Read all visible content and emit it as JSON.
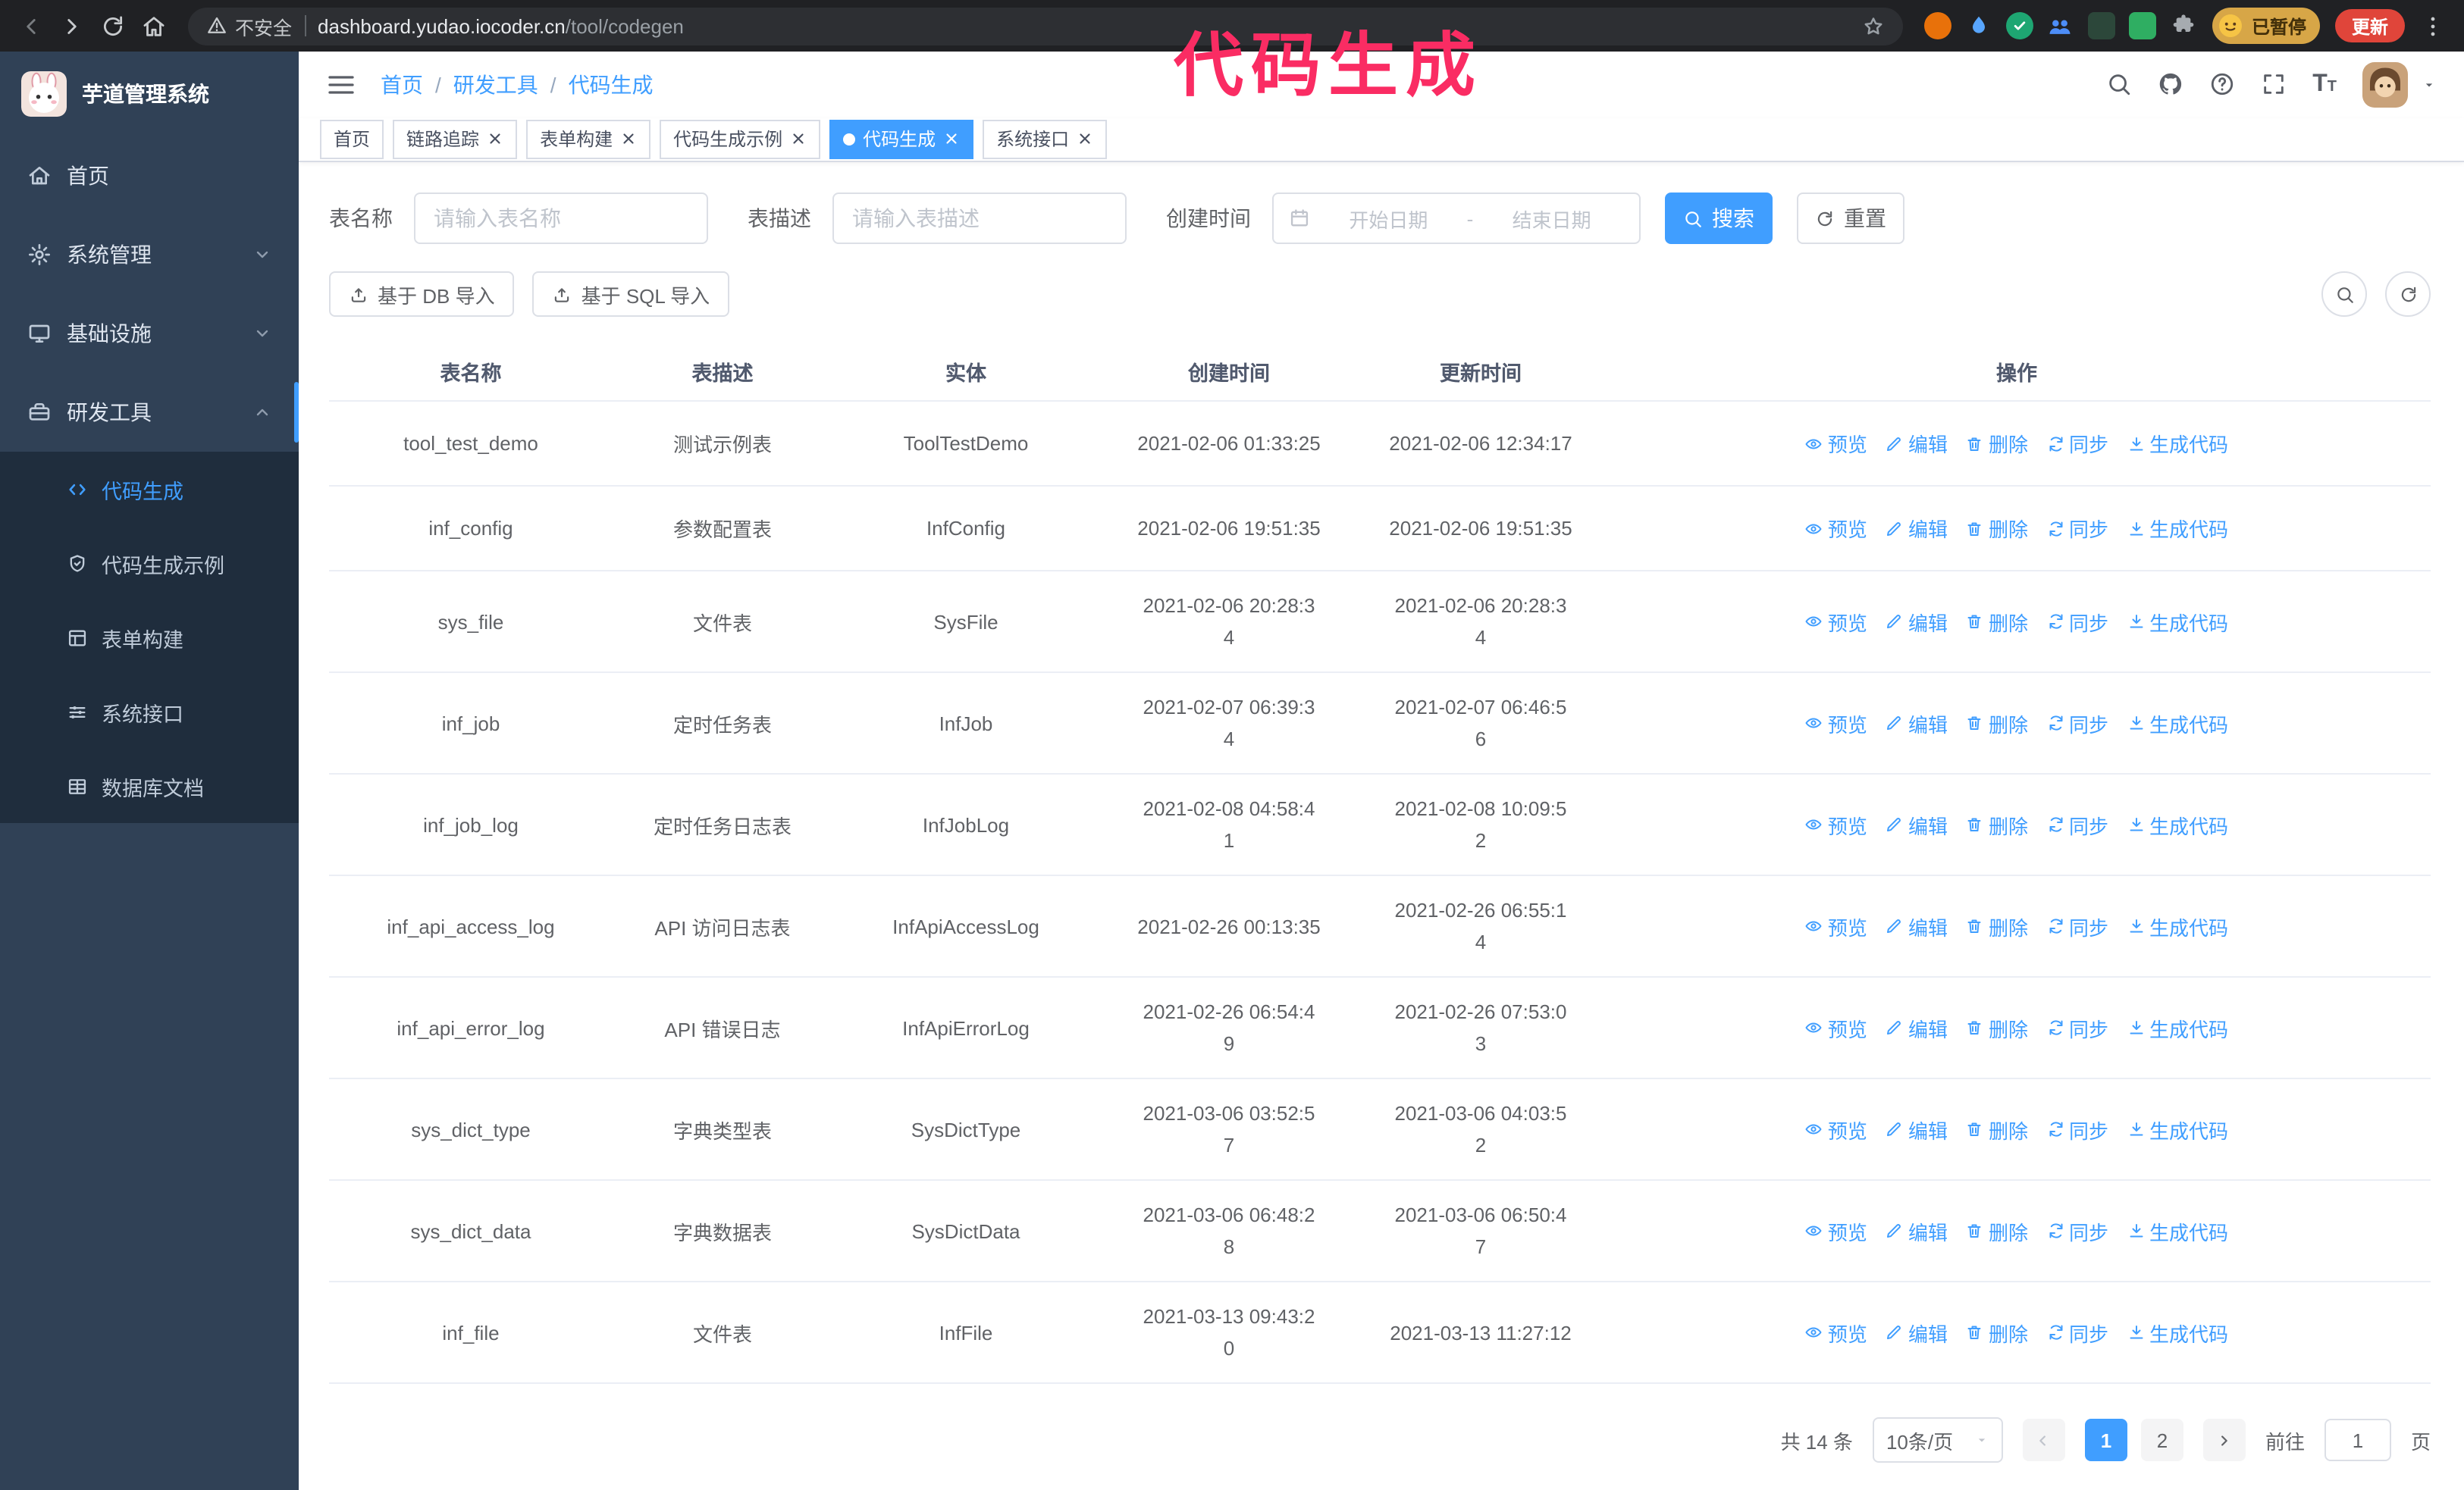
{
  "annotation": {
    "text": "代码生成",
    "color": "#fa2c63"
  },
  "browser": {
    "security_warning": "不安全",
    "url_domain": "dashboard.yudao.iocoder.cn",
    "url_path": "/tool/codegen",
    "sync_badge": "已暂停",
    "update_button": "更新",
    "extensions": [
      {
        "name": "orange-extension-icon",
        "kind": "circle",
        "color": "#e8710a"
      },
      {
        "name": "blue-drop-extension-icon",
        "kind": "drop",
        "color": "#58a6ff"
      },
      {
        "name": "green-check-extension-icon",
        "kind": "check",
        "color": "#1ea672"
      },
      {
        "name": "people-extension-icon",
        "kind": "people",
        "color": "#4d8df7"
      },
      {
        "name": "dark-green-extension-icon",
        "kind": "square",
        "color": "#2c473a"
      },
      {
        "name": "green-extension-icon",
        "kind": "square",
        "color": "#2fae62"
      },
      {
        "name": "puzzle-icon",
        "kind": "puzzle",
        "color": "#a6abb0"
      }
    ]
  },
  "sidebar": {
    "logo_title": "芋道管理系统",
    "items": [
      {
        "id": "home",
        "label": "首页",
        "icon": "home-icon"
      },
      {
        "id": "system",
        "label": "系统管理",
        "icon": "gear-icon",
        "expandable": true
      },
      {
        "id": "infra",
        "label": "基础设施",
        "icon": "infra-icon",
        "expandable": true
      },
      {
        "id": "devtools",
        "label": "研发工具",
        "icon": "tools-icon",
        "expanded": true
      }
    ],
    "submenu": [
      {
        "id": "codegen",
        "label": "代码生成",
        "icon": "code-icon",
        "active": true
      },
      {
        "id": "codegen-demo",
        "label": "代码生成示例",
        "icon": "example-icon"
      },
      {
        "id": "form-build",
        "label": "表单构建",
        "icon": "form-icon"
      },
      {
        "id": "api",
        "label": "系统接口",
        "icon": "api-icon"
      },
      {
        "id": "db-doc",
        "label": "数据库文档",
        "icon": "db-doc-icon"
      }
    ]
  },
  "navbar": {
    "breadcrumb": [
      "首页",
      "研发工具",
      "代码生成"
    ],
    "breadcrumb_separator": "/",
    "right_icons": [
      "search-icon",
      "github-icon",
      "help-icon",
      "fullscreen-icon",
      "font-size-icon",
      "avatar",
      "caret-down-icon"
    ]
  },
  "tabs": [
    {
      "label": "首页",
      "closable": false,
      "active": false
    },
    {
      "label": "链路追踪",
      "closable": true,
      "active": false
    },
    {
      "label": "表单构建",
      "closable": true,
      "active": false
    },
    {
      "label": "代码生成示例",
      "closable": true,
      "active": false
    },
    {
      "label": "代码生成",
      "closable": true,
      "active": true
    },
    {
      "label": "系统接口",
      "closable": true,
      "active": false
    }
  ],
  "filters": {
    "table_name_label": "表名称",
    "table_name_placeholder": "请输入表名称",
    "table_desc_label": "表描述",
    "table_desc_placeholder": "请输入表描述",
    "create_time_label": "创建时间",
    "date_start_placeholder": "开始日期",
    "date_separator": "-",
    "date_end_placeholder": "结束日期",
    "search_button": "搜索",
    "reset_button": "重置"
  },
  "toolbar": {
    "import_db": "基于 DB 导入",
    "import_sql": "基于 SQL 导入"
  },
  "table": {
    "columns": [
      "表名称",
      "表描述",
      "实体",
      "创建时间",
      "更新时间",
      "操作"
    ],
    "actions": [
      {
        "name": "preview-link",
        "label": "预览",
        "icon": "eye-icon"
      },
      {
        "name": "edit-link",
        "label": "编辑",
        "icon": "edit-icon"
      },
      {
        "name": "delete-link",
        "label": "删除",
        "icon": "delete-icon"
      },
      {
        "name": "sync-link",
        "label": "同步",
        "icon": "sync-icon"
      },
      {
        "name": "generate-code-link",
        "label": "生成代码",
        "icon": "download-icon"
      }
    ],
    "rows": [
      {
        "name": "tool_test_demo",
        "desc": "测试示例表",
        "entity": "ToolTestDemo",
        "created": "2021-02-06 01:33:25",
        "updated": "2021-02-06 12:34:17"
      },
      {
        "name": "inf_config",
        "desc": "参数配置表",
        "entity": "InfConfig",
        "created": "2021-02-06 19:51:35",
        "updated": "2021-02-06 19:51:35"
      },
      {
        "name": "sys_file",
        "desc": "文件表",
        "entity": "SysFile",
        "created": "2021-02-06 20:28:3\n4",
        "updated": "2021-02-06 20:28:3\n4"
      },
      {
        "name": "inf_job",
        "desc": "定时任务表",
        "entity": "InfJob",
        "created": "2021-02-07 06:39:3\n4",
        "updated": "2021-02-07 06:46:5\n6"
      },
      {
        "name": "inf_job_log",
        "desc": "定时任务日志表",
        "entity": "InfJobLog",
        "created": "2021-02-08 04:58:4\n1",
        "updated": "2021-02-08 10:09:5\n2"
      },
      {
        "name": "inf_api_access_log",
        "desc": "API 访问日志表",
        "entity": "InfApiAccessLog",
        "created": "2021-02-26 00:13:35",
        "updated": "2021-02-26 06:55:1\n4"
      },
      {
        "name": "inf_api_error_log",
        "desc": "API 错误日志",
        "entity": "InfApiErrorLog",
        "created": "2021-02-26 06:54:4\n9",
        "updated": "2021-02-26 07:53:0\n3"
      },
      {
        "name": "sys_dict_type",
        "desc": "字典类型表",
        "entity": "SysDictType",
        "created": "2021-03-06 03:52:5\n7",
        "updated": "2021-03-06 04:03:5\n2"
      },
      {
        "name": "sys_dict_data",
        "desc": "字典数据表",
        "entity": "SysDictData",
        "created": "2021-03-06 06:48:2\n8",
        "updated": "2021-03-06 06:50:4\n7"
      },
      {
        "name": "inf_file",
        "desc": "文件表",
        "entity": "InfFile",
        "created": "2021-03-13 09:43:2\n0",
        "updated": "2021-03-13 11:27:12"
      }
    ]
  },
  "pagination": {
    "total": "共 14 条",
    "page_size": "10条/页",
    "pages": [
      "1",
      "2"
    ],
    "active_page": "1",
    "goto_label": "前往",
    "goto_value": "1",
    "goto_suffix": "页"
  },
  "colors": {
    "primary": "#409eff",
    "sidebar_bg": "#304156",
    "submenu_bg": "#1f2d3d",
    "chrome_bg": "#202124",
    "update_button_bg": "#e0453a"
  }
}
